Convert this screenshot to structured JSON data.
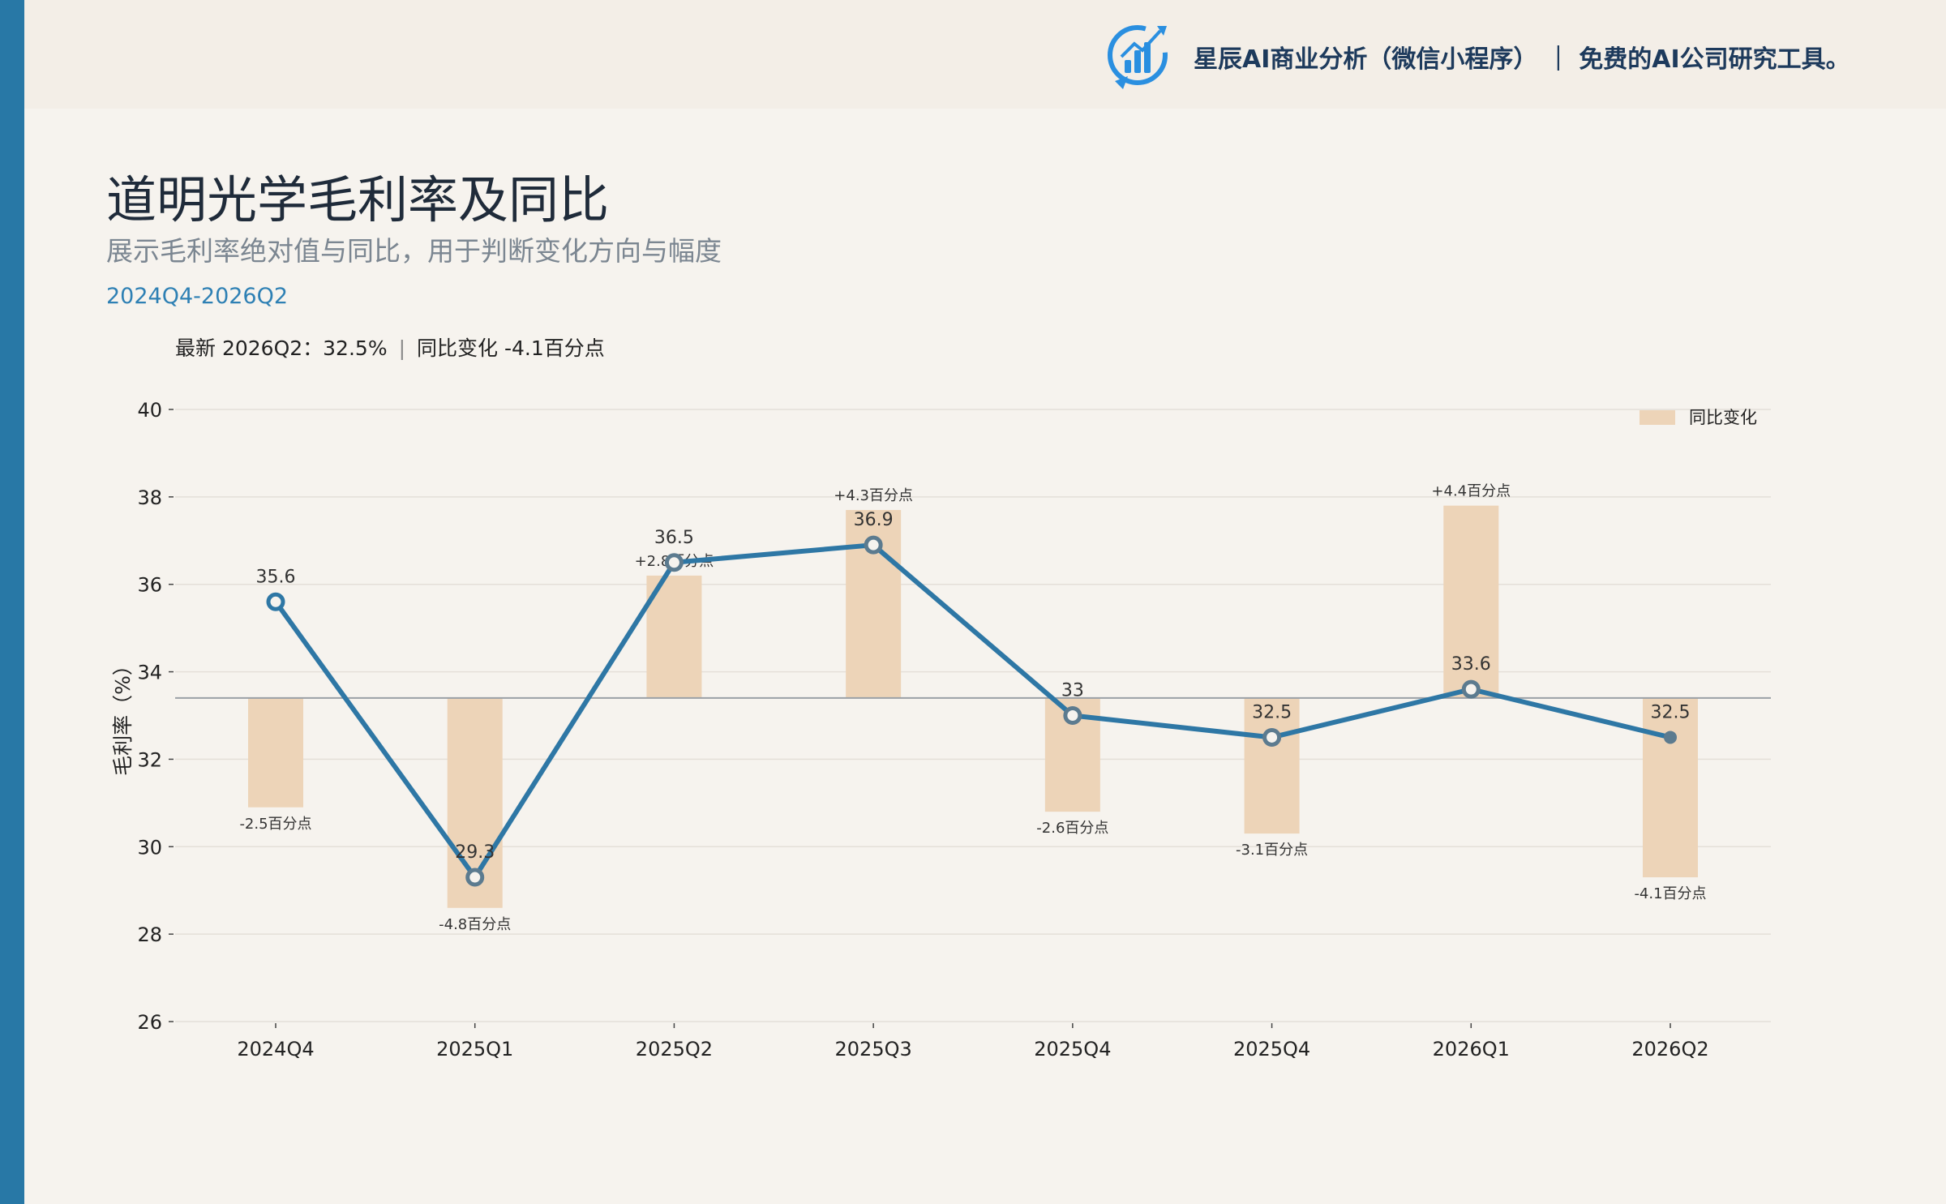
{
  "header": {
    "brand_text": "星辰AI商业分析（微信小程序） ｜ 免费的AI公司研究工具。",
    "logo_icon": "bar-chart-logo-icon"
  },
  "title": "道明光学毛利率及同比",
  "subtitle": "展示毛利率绝对值与同比，用于判断变化方向与幅度",
  "period": "2024Q4-2026Q2",
  "summary": {
    "latest": "最新 2026Q2：32.5%",
    "change": "同比变化 -4.1百分点"
  },
  "colors": {
    "line": "#2e77a5",
    "bar": "#edd4b8",
    "accent": "#2878a6",
    "text": "#1f2b3a"
  },
  "chart_data": {
    "type": "bar+line",
    "categories": [
      "2024Q4",
      "2025Q1",
      "2025Q2",
      "2025Q3",
      "2025Q4",
      "2025Q4",
      "2026Q1",
      "2026Q2"
    ],
    "series": [
      {
        "name": "毛利率",
        "type": "line",
        "values": [
          35.6,
          29.3,
          36.5,
          36.9,
          33,
          32.5,
          33.6,
          32.5
        ],
        "data_labels": [
          "35.6",
          "29.3",
          "36.5",
          "36.9",
          "33",
          "32.5",
          "33.6",
          "32.5"
        ]
      },
      {
        "name": "同比变化",
        "type": "bar",
        "baseline": 33.4,
        "values": [
          -2.5,
          -4.8,
          2.8,
          4.3,
          -2.6,
          -3.1,
          4.4,
          -4.1
        ],
        "data_labels": [
          "-2.5百分点",
          "-4.8百分点",
          "+2.8百分点",
          "+4.3百分点",
          "-2.6百分点",
          "-3.1百分点",
          "+4.4百分点",
          "-4.1百分点"
        ]
      }
    ],
    "ylabel": "毛利率（%）",
    "ylim": [
      26,
      40
    ],
    "yticks": [
      26,
      28,
      30,
      32,
      34,
      36,
      38,
      40
    ],
    "grid": true,
    "legend": {
      "position": "top-right",
      "entries": [
        "同比变化"
      ]
    }
  }
}
